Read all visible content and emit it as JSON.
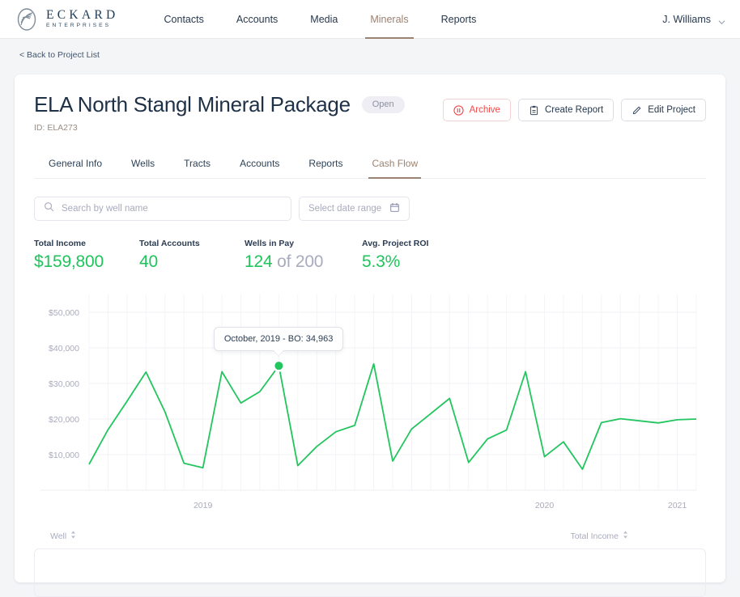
{
  "brand": {
    "name": "ECKARD",
    "tagline": "ENTERPRISES",
    "logo_icon": "leaf-oval-logo-icon"
  },
  "topnav": {
    "items": [
      {
        "label": "Contacts",
        "active": false
      },
      {
        "label": "Accounts",
        "active": false
      },
      {
        "label": "Media",
        "active": false
      },
      {
        "label": "Minerals",
        "active": true
      },
      {
        "label": "Reports",
        "active": false
      }
    ],
    "user": {
      "name": "J. Williams",
      "chevron_icon": "chevron-down-icon"
    }
  },
  "breadcrumb": {
    "back_label": "< Back to Project List"
  },
  "project": {
    "title": "ELA North Stangl Mineral Package",
    "status_badge": "Open",
    "id_label": "ID: ELA273"
  },
  "actions": {
    "archive": {
      "label": "Archive",
      "icon": "pause-circle-icon",
      "color": "#f04b4b"
    },
    "create_report": {
      "label": "Create Report",
      "icon": "clipboard-icon"
    },
    "edit_project": {
      "label": "Edit Project",
      "icon": "pencil-icon"
    }
  },
  "tabs": [
    {
      "label": "General Info",
      "active": false
    },
    {
      "label": "Wells",
      "active": false
    },
    {
      "label": "Tracts",
      "active": false
    },
    {
      "label": "Accounts",
      "active": false
    },
    {
      "label": "Reports",
      "active": false
    },
    {
      "label": "Cash Flow",
      "active": true
    }
  ],
  "filters": {
    "search": {
      "placeholder": "Search by well name",
      "value": "",
      "icon": "search-icon"
    },
    "date_range": {
      "label": "Select date range",
      "icon": "calendar-icon"
    }
  },
  "stats": [
    {
      "label": "Total Income",
      "value": "$159,800",
      "muted_suffix": ""
    },
    {
      "label": "Total Accounts",
      "value": "40",
      "muted_suffix": ""
    },
    {
      "label": "Wells in Pay",
      "value": "124",
      "muted_suffix": " of 200"
    },
    {
      "label": "Avg. Project ROI",
      "value": "5.3%",
      "muted_suffix": ""
    }
  ],
  "tooltip": {
    "text": "October, 2019 - BO: 34,963"
  },
  "table": {
    "columns": [
      {
        "label": "Well",
        "sort_icon": "sort-arrows-icon"
      },
      {
        "label": "Total Income",
        "sort_icon": "sort-arrows-icon"
      }
    ],
    "rows": []
  },
  "chart_data": {
    "type": "line",
    "title": "",
    "xlabel": "",
    "ylabel": "",
    "line_color": "#22c55e",
    "grid": true,
    "legend": null,
    "ylim": [
      0,
      55000
    ],
    "ytick_labels": [
      "$50,000",
      "$40,000",
      "$30,000",
      "$20,000",
      "$10,000"
    ],
    "yticks": [
      50000,
      40000,
      30000,
      20000,
      10000
    ],
    "xtick_labels": [
      "2019",
      "2020",
      "2021"
    ],
    "xticks": [
      6,
      24,
      31
    ],
    "highlight_point": {
      "x": 10,
      "y": 34963,
      "label": "October, 2019 - BO: 34,963"
    },
    "x": [
      0,
      1,
      2,
      3,
      4,
      5,
      6,
      7,
      8,
      9,
      10,
      11,
      12,
      13,
      14,
      15,
      16,
      17,
      18,
      19,
      20,
      21,
      22,
      23,
      24,
      25,
      26,
      27,
      28,
      29,
      30,
      31,
      32
    ],
    "values": [
      7300,
      17000,
      25000,
      33200,
      22000,
      7600,
      6300,
      33300,
      24500,
      27700,
      34963,
      6900,
      12300,
      16400,
      18200,
      35500,
      8200,
      17200,
      21500,
      25800,
      7800,
      14400,
      16900,
      33300,
      9400,
      13600,
      5900,
      19000,
      20100,
      19500,
      18900,
      19800,
      20000
    ]
  }
}
